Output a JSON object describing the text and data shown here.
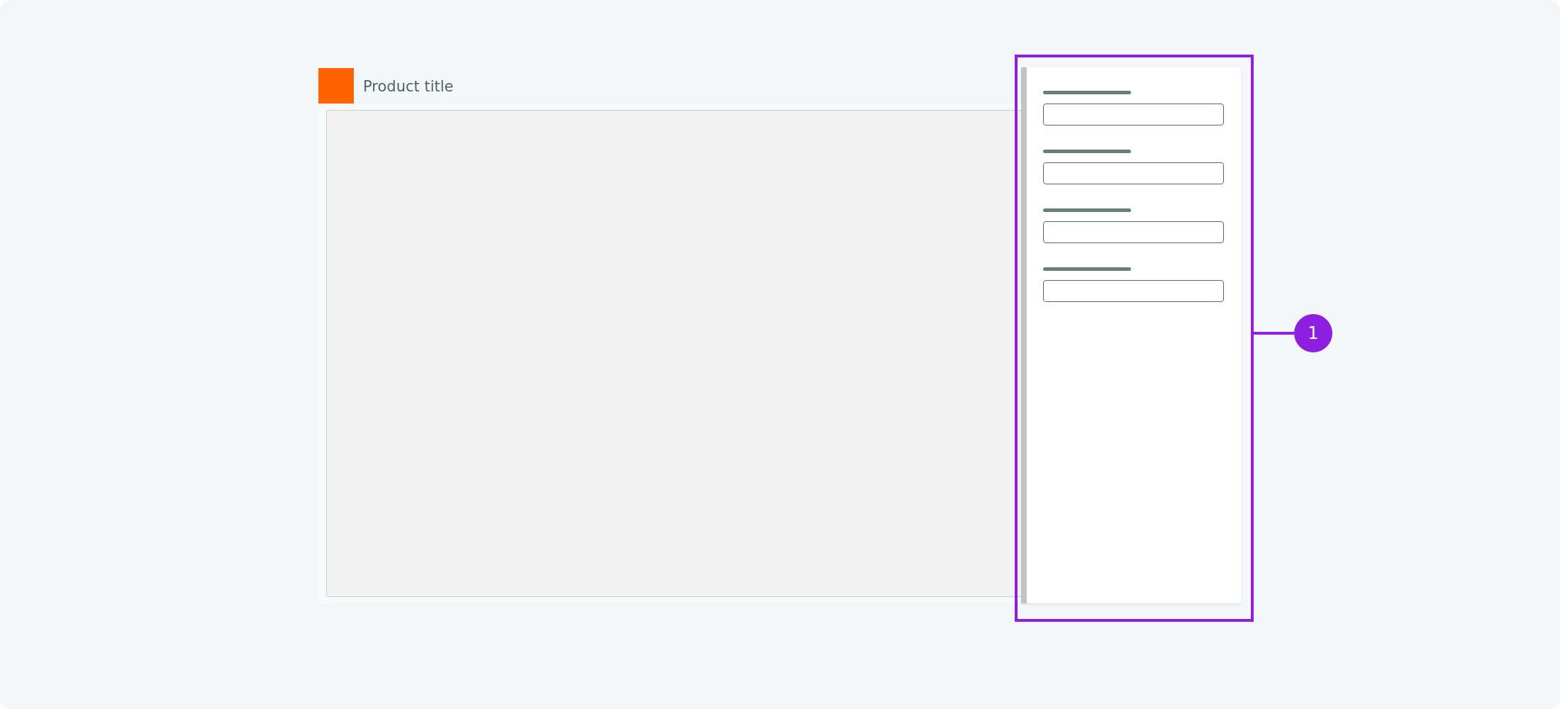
{
  "header": {
    "title": "Product title"
  },
  "panel": {
    "fields": [
      {
        "kind": "input"
      },
      {
        "kind": "input"
      },
      {
        "kind": "input"
      },
      {
        "kind": "input"
      }
    ]
  },
  "callout": {
    "number": "1"
  }
}
